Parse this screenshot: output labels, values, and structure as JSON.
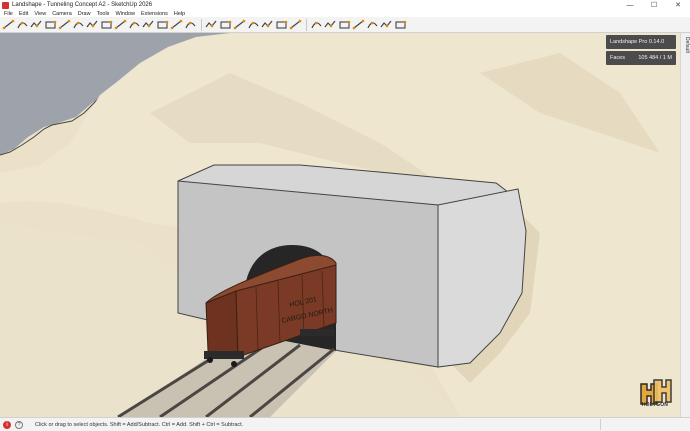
{
  "window": {
    "title": "Landshape - Tunneling Concept A2 - SketchUp 2026",
    "controls": {
      "minimize": "—",
      "maximize": "☐",
      "close": "✕"
    }
  },
  "menu": [
    "File",
    "Edit",
    "View",
    "Camera",
    "Draw",
    "Tools",
    "Window",
    "Extensions",
    "Help"
  ],
  "toolbar": {
    "icons": [
      "line-tool",
      "arc-tool",
      "freehand-tool",
      "curve-tool",
      "polyline-tool",
      "spline-tool",
      "bezier-tool",
      "cube-tool",
      "road-tool",
      "path-tool",
      "offset-tool",
      "grid-tool",
      "plane-tool",
      "terrain-tool",
      "tree-tool",
      "color-tool",
      "contour-tool",
      "profile-tool",
      "section-tool",
      "slope-tool",
      "wave-tool",
      "sculpt-tool",
      "pin-tool",
      "smooth-tool",
      "stamp-tool",
      "flatten-tool",
      "lasso-tool",
      "orbit-tool"
    ],
    "accent": "#e08a00"
  },
  "tray": {
    "tab_label": "Default"
  },
  "info_panel": {
    "product": "Landshape Pro 0.14.0",
    "faces_label": "Faces",
    "faces_value": "105 484  /  1 M"
  },
  "logo": {
    "text": "HOLYGON"
  },
  "status": {
    "message": "Click or drag to select objects. Shift = Add/Subtract. Ctrl = Add. Shift + Ctrl = Subtract."
  },
  "scene": {
    "railcar_lettering": [
      "HOL 201",
      "CARGO NORTH"
    ],
    "colors": {
      "sky": "#9ea3ab",
      "terrain": "#ede3cc",
      "terrain_shadow": "#ddd1b6",
      "portal": "#c6c6c6",
      "railcar": "#7a3a25",
      "rails": "#4a4742"
    }
  }
}
